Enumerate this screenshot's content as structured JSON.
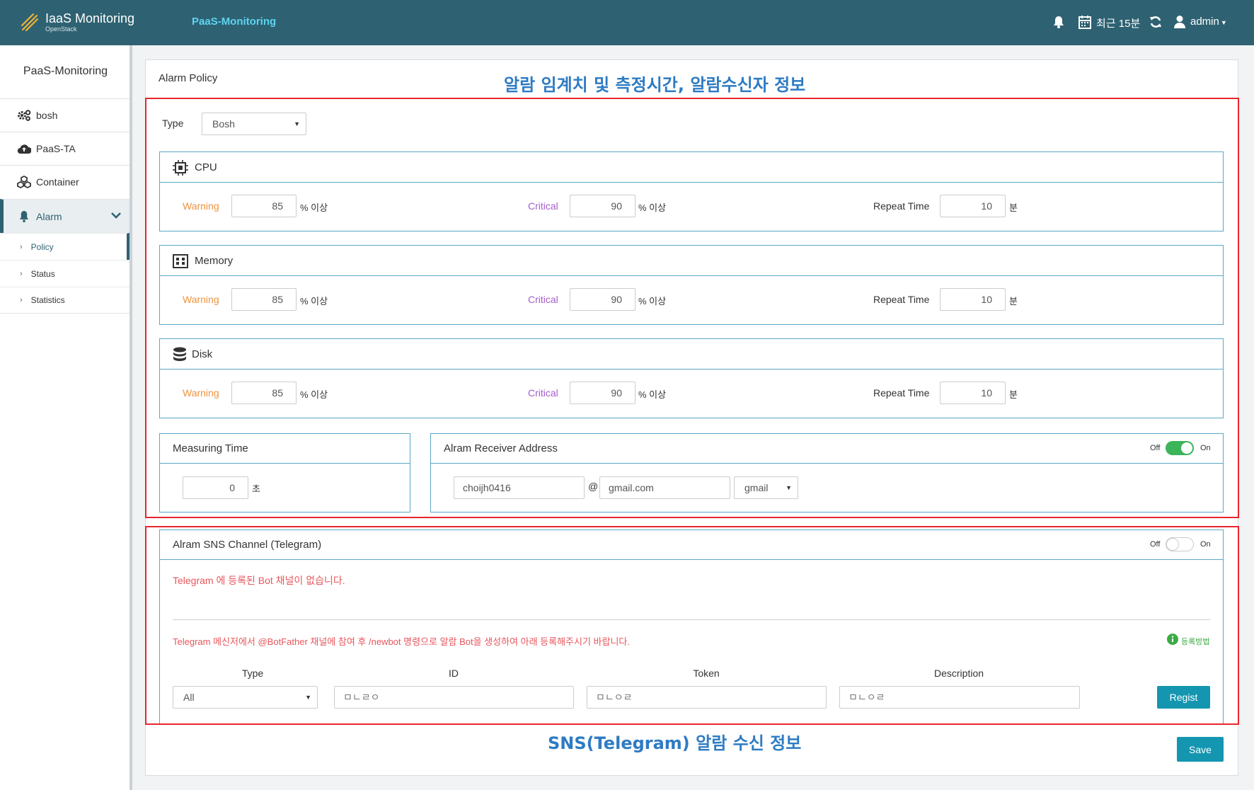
{
  "header": {
    "brand_title": "IaaS Monitoring",
    "brand_sub": "OpenStack",
    "nav_paas": "PaaS-Monitoring",
    "time_range": "최근 15분",
    "user": "admin"
  },
  "sidebar": {
    "title": "PaaS-Monitoring",
    "items": [
      {
        "label": "bosh",
        "icon": "gears-icon"
      },
      {
        "label": "PaaS-TA",
        "icon": "cloud-upload-icon"
      },
      {
        "label": "Container",
        "icon": "cubes-icon"
      },
      {
        "label": "Alarm",
        "icon": "bell-icon"
      }
    ],
    "sub_items": [
      "Policy",
      "Status",
      "Statistics"
    ]
  },
  "panel": {
    "title": "Alarm Policy",
    "annotation_top": "알람 임계치 및 측정시간, 알람수신자 정보",
    "annotation_bottom": "SNS(Telegram) 알람 수신 정보",
    "type_label": "Type",
    "type_value": "Bosh",
    "save_label": "Save"
  },
  "thresholds": [
    {
      "name": "CPU",
      "icon": "chip-icon",
      "warning_label": "Warning",
      "warning": "85",
      "critical_label": "Critical",
      "critical": "90",
      "unit": "% 이상",
      "repeat_label": "Repeat Time",
      "repeat": "10",
      "repeat_unit": "분"
    },
    {
      "name": "Memory",
      "icon": "memory-icon",
      "warning_label": "Warning",
      "warning": "85",
      "critical_label": "Critical",
      "critical": "90",
      "unit": "% 이상",
      "repeat_label": "Repeat Time",
      "repeat": "10",
      "repeat_unit": "분"
    },
    {
      "name": "Disk",
      "icon": "database-icon",
      "warning_label": "Warning",
      "warning": "85",
      "critical_label": "Critical",
      "critical": "90",
      "unit": "% 이상",
      "repeat_label": "Repeat Time",
      "repeat": "10",
      "repeat_unit": "분"
    }
  ],
  "measuring": {
    "title": "Measuring Time",
    "value": "0",
    "unit": "초"
  },
  "receiver": {
    "title": "Alram Receiver Address",
    "off": "Off",
    "on": "On",
    "enabled": true,
    "email_user": "choijh0416",
    "at": "@",
    "email_domain": "gmail.com",
    "provider": "gmail"
  },
  "sns": {
    "title": "Alram SNS Channel (Telegram)",
    "off": "Off",
    "on": "On",
    "enabled": false,
    "no_bot_msg": "Telegram 에 등록된 Bot 채널이 없습니다.",
    "guide_msg": "Telegram 메신저에서 @BotFather 채널에 참여 후 /newbot 명령으로 알람 Bot을 생성하여 아래 등록해주시기 바랍니다.",
    "howto": "등록방법",
    "col_type": "Type",
    "col_id": "ID",
    "col_token": "Token",
    "col_desc": "Description",
    "type_value": "All",
    "id_placeholder": "ㅁㄴㄹㅇ",
    "token_placeholder": "ㅁㄴㅇㄹ",
    "desc_placeholder": "ㅁㄴㅇㄹ",
    "regist_label": "Regist"
  },
  "colors": {
    "header_bg": "#2e6272",
    "accent": "#1496b0",
    "warning": "#f0923b",
    "critical": "#a65ccd",
    "annotation": "#2e7bc4",
    "highlight_border": "#e8262d",
    "toggle_on": "#3cb55a"
  }
}
